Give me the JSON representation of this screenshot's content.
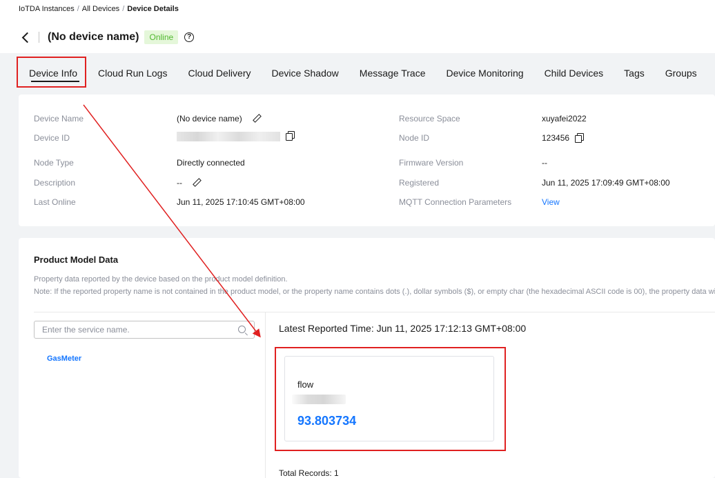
{
  "breadcrumb": {
    "items": [
      "IoTDA Instances",
      "All Devices"
    ],
    "separator": "/",
    "current": "Device Details"
  },
  "header": {
    "title": "(No device name)",
    "status": "Online",
    "help_icon": "question-circle-icon",
    "back_icon": "chevron-left-icon"
  },
  "tabs": [
    {
      "label": "Device Info",
      "active": true
    },
    {
      "label": "Cloud Run Logs"
    },
    {
      "label": "Cloud Delivery"
    },
    {
      "label": "Device Shadow"
    },
    {
      "label": "Message Trace"
    },
    {
      "label": "Device Monitoring"
    },
    {
      "label": "Child Devices"
    },
    {
      "label": "Tags"
    },
    {
      "label": "Groups"
    }
  ],
  "device_info": {
    "device_name": {
      "label": "Device Name",
      "value": "(No device name)"
    },
    "device_id": {
      "label": "Device ID"
    },
    "node_type": {
      "label": "Node Type",
      "value": "Directly connected"
    },
    "description": {
      "label": "Description",
      "value": "--"
    },
    "last_online": {
      "label": "Last Online",
      "value": "Jun 11, 2025 17:10:45 GMT+08:00"
    },
    "resource_space": {
      "label": "Resource Space",
      "value": "xuyafei2022"
    },
    "node_id": {
      "label": "Node ID",
      "value": "123456"
    },
    "firmware_version": {
      "label": "Firmware Version",
      "value": "--"
    },
    "registered": {
      "label": "Registered",
      "value": "Jun 11, 2025 17:09:49 GMT+08:00"
    },
    "mqtt": {
      "label": "MQTT Connection Parameters",
      "link": "View"
    }
  },
  "product_model": {
    "title": "Product Model Data",
    "description": "Property data reported by the device based on the product model definition.",
    "note": "Note: If the reported property name is not contained in the product model, or the property name contains dots (.), dollar symbols ($), or empty char (the hexadecimal ASCII code is 00), the property data will not be displayed.",
    "search_placeholder": "Enter the service name.",
    "services": [
      "GasMeter"
    ],
    "latest_reported": "Latest Reported Time: Jun 11, 2025 17:12:13 GMT+08:00",
    "property": {
      "name": "flow",
      "value": "93.803734"
    },
    "total_records": "Total Records: 1"
  },
  "annotation_color": "#e02020",
  "colors": {
    "accent": "#1476ff",
    "online_bg": "#e5f7da",
    "online_text": "#50b82f"
  }
}
